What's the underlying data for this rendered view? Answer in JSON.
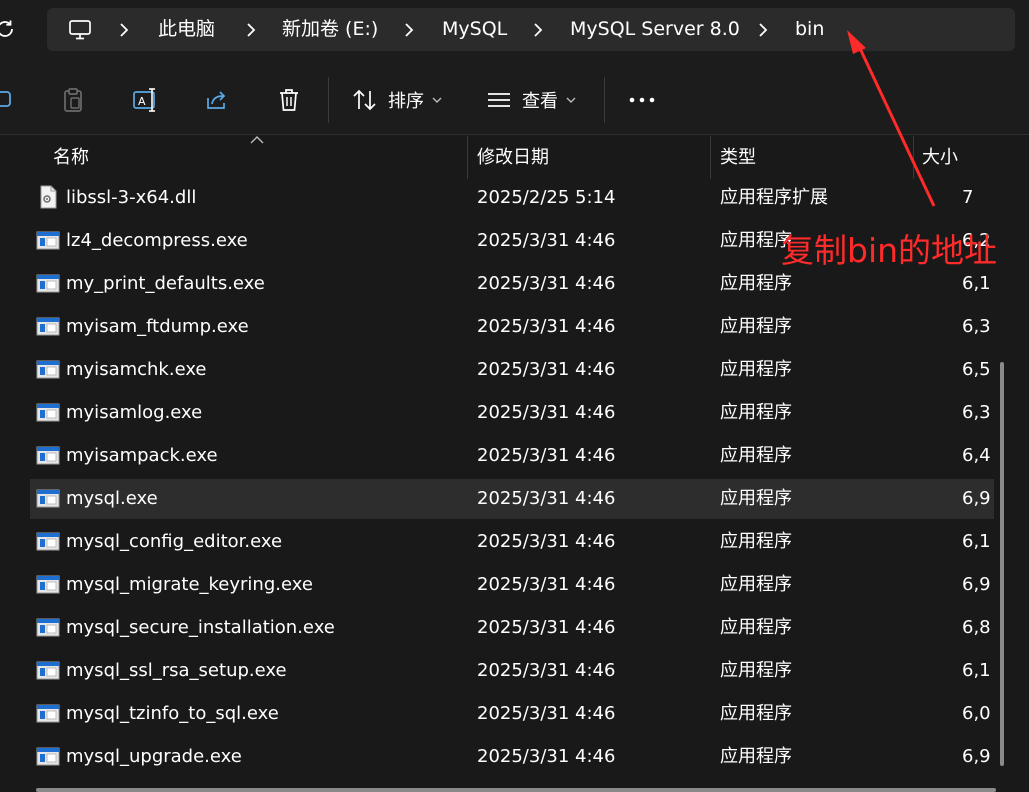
{
  "breadcrumb": {
    "items": [
      "此电脑",
      "新加卷 (E:)",
      "MySQL",
      "MySQL Server 8.0",
      "bin"
    ]
  },
  "toolbar": {
    "sort_label": "排序",
    "view_label": "查看"
  },
  "columns": {
    "name": "名称",
    "date": "修改日期",
    "type": "类型",
    "size": "大小"
  },
  "files": [
    {
      "name": "libssl-3-x64.dll",
      "date": "2025/2/25 5:14",
      "type": "应用程序扩展",
      "size": "7",
      "icon": "dll-file-icon"
    },
    {
      "name": "lz4_decompress.exe",
      "date": "2025/3/31 4:46",
      "type": "应用程序",
      "size": "6,2",
      "icon": "exe-file-icon"
    },
    {
      "name": "my_print_defaults.exe",
      "date": "2025/3/31 4:46",
      "type": "应用程序",
      "size": "6,1",
      "icon": "exe-file-icon"
    },
    {
      "name": "myisam_ftdump.exe",
      "date": "2025/3/31 4:46",
      "type": "应用程序",
      "size": "6,3",
      "icon": "exe-file-icon"
    },
    {
      "name": "myisamchk.exe",
      "date": "2025/3/31 4:46",
      "type": "应用程序",
      "size": "6,5",
      "icon": "exe-file-icon"
    },
    {
      "name": "myisamlog.exe",
      "date": "2025/3/31 4:46",
      "type": "应用程序",
      "size": "6,3",
      "icon": "exe-file-icon"
    },
    {
      "name": "myisampack.exe",
      "date": "2025/3/31 4:46",
      "type": "应用程序",
      "size": "6,4",
      "icon": "exe-file-icon"
    },
    {
      "name": "mysql.exe",
      "date": "2025/3/31 4:46",
      "type": "应用程序",
      "size": "6,9",
      "icon": "exe-file-icon",
      "selected": true
    },
    {
      "name": "mysql_config_editor.exe",
      "date": "2025/3/31 4:46",
      "type": "应用程序",
      "size": "6,1",
      "icon": "exe-file-icon"
    },
    {
      "name": "mysql_migrate_keyring.exe",
      "date": "2025/3/31 4:46",
      "type": "应用程序",
      "size": "6,9",
      "icon": "exe-file-icon"
    },
    {
      "name": "mysql_secure_installation.exe",
      "date": "2025/3/31 4:46",
      "type": "应用程序",
      "size": "6,8",
      "icon": "exe-file-icon"
    },
    {
      "name": "mysql_ssl_rsa_setup.exe",
      "date": "2025/3/31 4:46",
      "type": "应用程序",
      "size": "6,1",
      "icon": "exe-file-icon"
    },
    {
      "name": "mysql_tzinfo_to_sql.exe",
      "date": "2025/3/31 4:46",
      "type": "应用程序",
      "size": "6,0",
      "icon": "exe-file-icon"
    },
    {
      "name": "mysql_upgrade.exe",
      "date": "2025/3/31 4:46",
      "type": "应用程序",
      "size": "6,9",
      "icon": "exe-file-icon"
    }
  ],
  "annotation": {
    "text": "复制bin的地址",
    "color": "#ff2a2a"
  },
  "colors": {
    "background": "#191919",
    "address_bar": "#2b2b2b",
    "selected_row": "#2d2d2d",
    "annotation_red": "#ff2a2a"
  }
}
